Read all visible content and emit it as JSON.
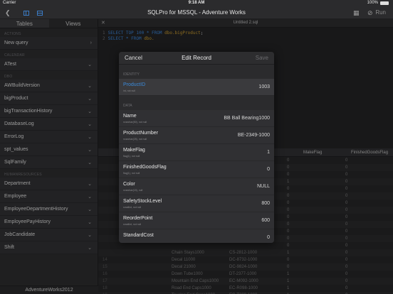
{
  "status": {
    "carrier": "Carrier",
    "time": "9:18 AM",
    "battery": "100%"
  },
  "nav": {
    "title": "SQLPro for MSSQL - Adventure Works",
    "run_label": "Run"
  },
  "sidebar": {
    "tabs": [
      "Tables",
      "Views"
    ],
    "sections": {
      "actions": "ACTIONS",
      "calendar": "CALENDAR",
      "dbo": "DBO",
      "humanresources": "HUMANRESOURCES"
    },
    "actions": [
      "New query"
    ],
    "calendar": [
      "ATest"
    ],
    "dbo": [
      "AWBuildVersion",
      "bigProduct",
      "bigTransactionHistory",
      "DatabaseLog",
      "ErrorLog",
      "spt_values",
      "SqlFamily"
    ],
    "humanresources": [
      "Department",
      "Employee",
      "EmployeeDepartmentHistory",
      "EmployeePayHistory",
      "JobCandidate",
      "Shift"
    ],
    "footer": "AdventureWorks2012"
  },
  "editor": {
    "tab_title": "Untitled 2.sql",
    "close_glyph": "✕",
    "lines": [
      {
        "num": "1",
        "kw1": "SELECT TOP 100 * FROM ",
        "tbl": "dbo.bigProduct",
        "tail": ";"
      },
      {
        "num": "2",
        "kw1": "SELECT * FROM ",
        "tbl": "dbo.",
        "tail": ""
      }
    ]
  },
  "grid": {
    "headers": {
      "makeflag": "MakeFlag",
      "finished": "FinishedGoodsFlag"
    },
    "rows": [
      {
        "num": "",
        "pid": "",
        "name": "",
        "pn": "",
        "mf": "0",
        "fg": "0"
      },
      {
        "num": "",
        "pid": "",
        "name": "",
        "pn": "",
        "mf": "0",
        "fg": "0"
      },
      {
        "num": "",
        "pid": "",
        "name": "",
        "pn": "",
        "mf": "0",
        "fg": "0"
      },
      {
        "num": "",
        "pid": "",
        "name": "",
        "pn": "",
        "mf": "1",
        "fg": "0"
      },
      {
        "num": "",
        "pid": "",
        "name": "",
        "pn": "",
        "mf": "0",
        "fg": "0"
      },
      {
        "num": "",
        "pid": "",
        "name": "",
        "pn": "",
        "mf": "0",
        "fg": "0"
      },
      {
        "num": "",
        "pid": "",
        "name": "",
        "pn": "",
        "mf": "0",
        "fg": "0"
      },
      {
        "num": "",
        "pid": "",
        "name": "",
        "pn": "",
        "mf": "0",
        "fg": "0"
      },
      {
        "num": "",
        "pid": "",
        "name": "",
        "pn": "",
        "mf": "0",
        "fg": "0"
      },
      {
        "num": "",
        "pid": "",
        "name": "",
        "pn": "",
        "mf": "0",
        "fg": "0"
      },
      {
        "num": "",
        "pid": "",
        "name": "",
        "pn": "",
        "mf": "0",
        "fg": "0"
      },
      {
        "num": "",
        "pid": "",
        "name": "",
        "pn": "",
        "mf": "0",
        "fg": "0"
      },
      {
        "num": "",
        "pid": "",
        "name": "",
        "pn": "",
        "mf": "0",
        "fg": "0"
      },
      {
        "num": "",
        "pid": "",
        "name": "Chain Stays1000",
        "pn": "CS-2812-1000",
        "mf": "1",
        "fg": "0"
      },
      {
        "num": "14",
        "pid": "",
        "name": "Decal 11000",
        "pn": "DC-8732-1000",
        "mf": "0",
        "fg": "0"
      },
      {
        "num": "15",
        "pid": "",
        "name": "Decal 21000",
        "pn": "DC-9824-1000",
        "mf": "0",
        "fg": "0"
      },
      {
        "num": "16",
        "pid": "",
        "name": "Down Tube1000",
        "pn": "DT-2377-1000",
        "mf": "1",
        "fg": "0"
      },
      {
        "num": "17",
        "pid": "",
        "name": "Mountain End Caps1000",
        "pn": "EC-M092-1000",
        "mf": "1",
        "fg": "0"
      },
      {
        "num": "18",
        "pid": "",
        "name": "Road End Caps1000",
        "pn": "EC-R098-1000",
        "mf": "1",
        "fg": "0"
      },
      {
        "num": "19",
        "pid": "",
        "name": "Touring End Caps1000",
        "pn": "EC-T209-1000",
        "mf": "1",
        "fg": "0"
      }
    ]
  },
  "modal": {
    "cancel": "Cancel",
    "title": "Edit Record",
    "save": "Save",
    "identity_section": "IDENTITY",
    "data_section": "DATA",
    "identity": {
      "name": "ProductID",
      "sub": "int, not null",
      "value": "1003"
    },
    "fields": [
      {
        "name": "Name",
        "sub": "nvarchar(50), not null",
        "value": "BB Ball Bearing1000"
      },
      {
        "name": "ProductNumber",
        "sub": "nvarchar(25), not null",
        "value": "BE-2349-1000"
      },
      {
        "name": "MakeFlag",
        "sub": "flag(1), not null",
        "value": "1"
      },
      {
        "name": "FinishedGoodsFlag",
        "sub": "flag(1), not null",
        "value": "0"
      },
      {
        "name": "Color",
        "sub": "nvarchar(15), null",
        "value": "NULL"
      },
      {
        "name": "SafetyStockLevel",
        "sub": "smallint, not null",
        "value": "800"
      },
      {
        "name": "ReorderPoint",
        "sub": "smallint, not null",
        "value": "600"
      },
      {
        "name": "StandardCost",
        "sub": "",
        "value": "0"
      }
    ]
  }
}
